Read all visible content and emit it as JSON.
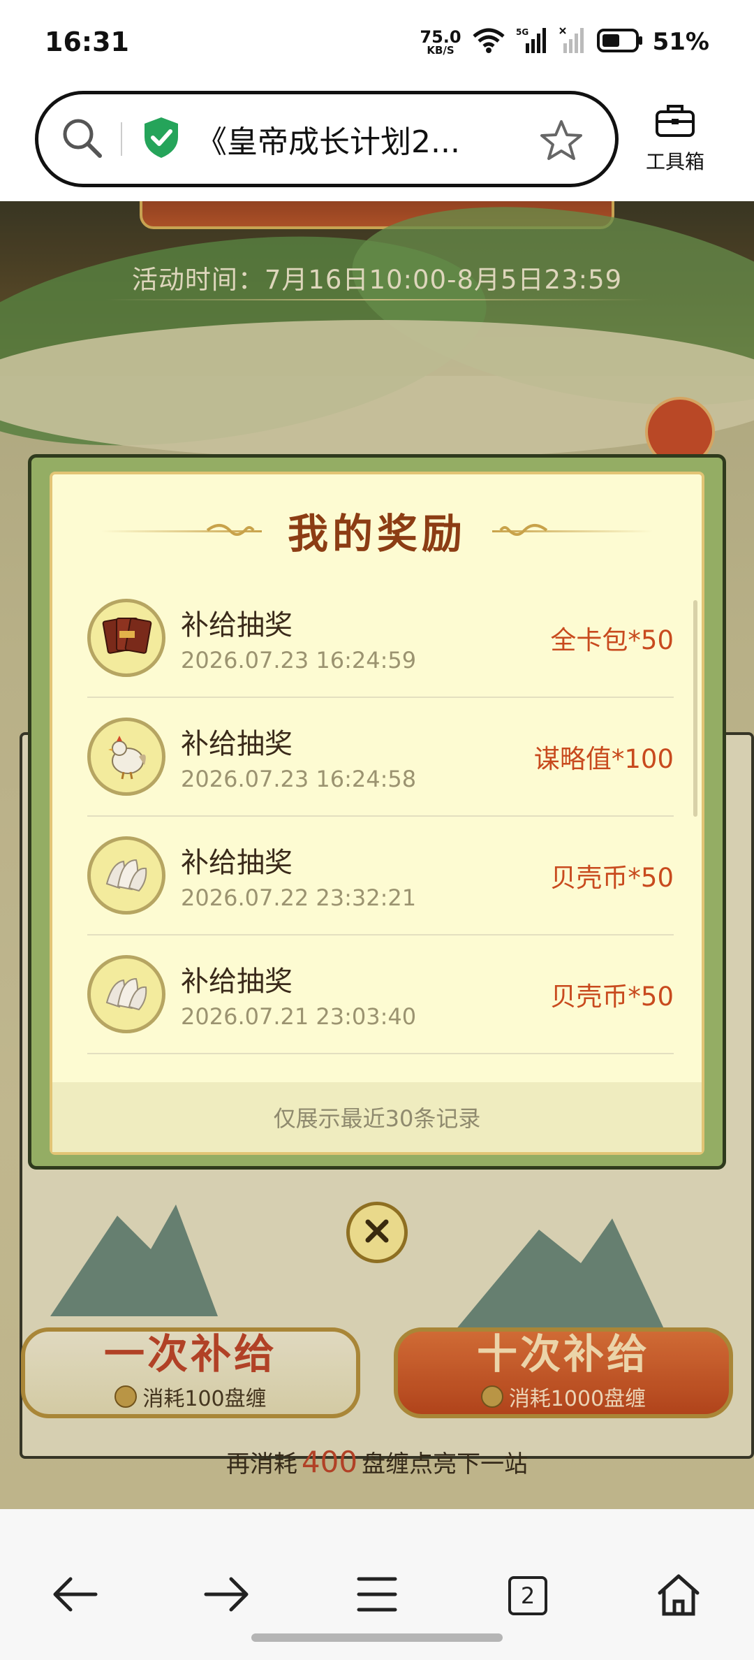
{
  "status_bar": {
    "time": "16:31",
    "net_speed_value": "75.0",
    "net_speed_unit": "KB/S",
    "network": "5G",
    "battery_percent": "51%"
  },
  "browser": {
    "url_title": "《皇帝成长计划2...",
    "toolbox_label": "工具箱",
    "tab_count": "2"
  },
  "event": {
    "time_text": "活动时间：7月16日10:00-8月5日23:59"
  },
  "rewards_modal": {
    "title": "我的奖励",
    "items": [
      {
        "name": "补给抽奖",
        "date": "2026.07.23 16:24:59",
        "reward": "全卡包*50",
        "icon": "card-pack-icon"
      },
      {
        "name": "补给抽奖",
        "date": "2026.07.23 16:24:58",
        "reward": "谋略值*100",
        "icon": "strategy-rooster-icon"
      },
      {
        "name": "补给抽奖",
        "date": "2026.07.22 23:32:21",
        "reward": "贝壳币*50",
        "icon": "shell-coin-icon"
      },
      {
        "name": "补给抽奖",
        "date": "2026.07.21 23:03:40",
        "reward": "贝壳币*50",
        "icon": "shell-coin-icon"
      }
    ],
    "footer": "仅展示最近30条记录"
  },
  "actions": {
    "once_title": "一次补给",
    "once_cost": "消耗100盘缠",
    "ten_title": "十次补给",
    "ten_cost": "消耗1000盘缠"
  },
  "progress": {
    "prefix": "再消耗",
    "amount": "400",
    "suffix": "盘缠点亮下一站"
  },
  "colors": {
    "reward_text": "#c84a1e",
    "modal_bg": "#fdfbd2",
    "modal_frame": "#94ad64",
    "title": "#8c3d14"
  }
}
